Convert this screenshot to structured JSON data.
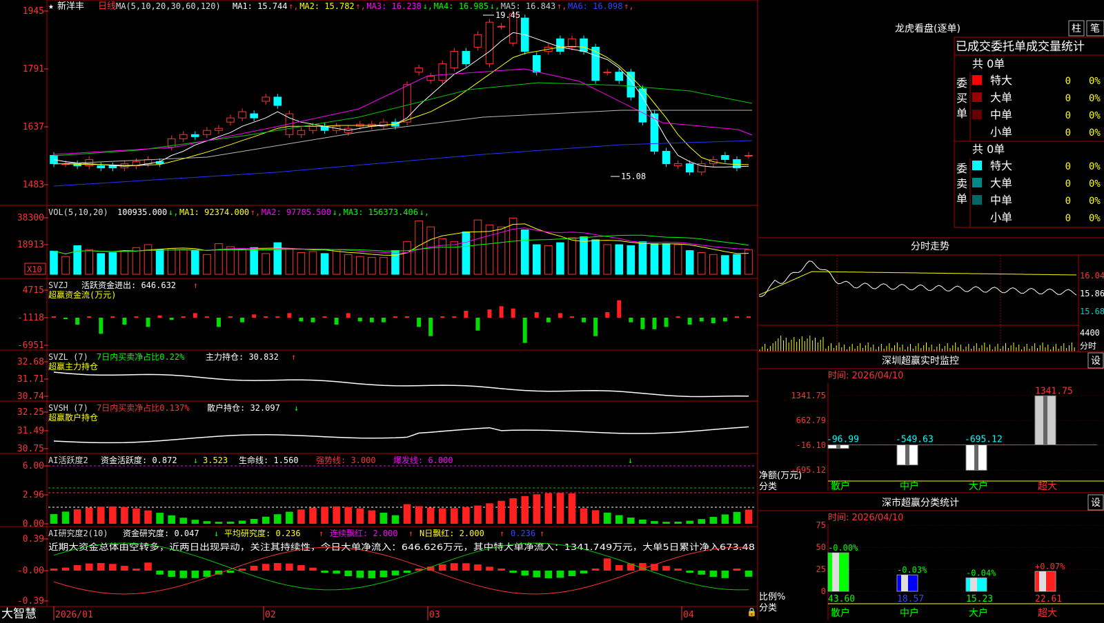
{
  "stock": {
    "name": "新洋丰",
    "period": "日线"
  },
  "main_chart": {
    "ma_label": "MA(5,10,20,30,60,120)",
    "ma_values": [
      {
        "label": "MA1:",
        "value": "15.744",
        "arrow": "↑",
        "color": "#ffffff"
      },
      {
        "label": "MA2:",
        "value": "15.782",
        "arrow": "↑",
        "color": "#ffff00"
      },
      {
        "label": "MA3:",
        "value": "16.238",
        "arrow": "↓",
        "color": "#ff00ff"
      },
      {
        "label": "MA4:",
        "value": "16.985",
        "arrow": "↓",
        "color": "#00ff00"
      },
      {
        "label": "MA5:",
        "value": "16.843",
        "arrow": "↑",
        "color": "#cccccc"
      },
      {
        "label": "MA6:",
        "value": "16.098",
        "arrow": "↑",
        "color": "#3344ff"
      }
    ],
    "y_ticks": [
      "1945",
      "1791",
      "1637",
      "1483"
    ],
    "high_label": "19.45",
    "low_label": "15.08"
  },
  "vol_panel": {
    "title": "VOL(5,10,20)",
    "values": [
      {
        "label": "",
        "value": "100935.000",
        "arrow": "↓",
        "color": "#ffffff"
      },
      {
        "label": "MA1:",
        "value": "92374.000",
        "arrow": "↑",
        "color": "#ffff00"
      },
      {
        "label": "MA2:",
        "value": "97785.500",
        "arrow": "↓",
        "color": "#ff00ff"
      },
      {
        "label": "MA3:",
        "value": "156373.406",
        "arrow": "↓",
        "color": "#00ff00"
      }
    ],
    "y_ticks": [
      "38300",
      "18913"
    ],
    "unit": "X10"
  },
  "svzj_panel": {
    "title": "SVZJ",
    "line1": "活跃资金进出: 646.632",
    "arrow": "↑",
    "line2": "超赢资金流(万元)",
    "y_ticks": [
      "4715",
      "-1118",
      "-6951"
    ]
  },
  "svzl_panel": {
    "title": "SVZL (7)",
    "ratio": "7日内买卖净占比0.22%",
    "hold": "主力持仓: 30.832",
    "arrow": "↑",
    "line2": "超赢主力持仓",
    "y_ticks": [
      "32.68",
      "31.71",
      "30.74"
    ]
  },
  "svsh_panel": {
    "title": "SVSH (7)",
    "ratio": "7日内买卖净占比0.137%",
    "hold": "散户持仓: 32.097",
    "arrow": "↓",
    "line2": "超赢散户持仓",
    "y_ticks": [
      "32.25",
      "31.49",
      "30.75"
    ]
  },
  "ai_active": {
    "title": "AI活跃度2",
    "a": "资金活跃度: 0.872",
    "a_arrow": "↓",
    "b": "3.523",
    "c": "生命线: 1.560",
    "d": "强势线: 3.000",
    "e": "爆发线: 6.000",
    "y_ticks": [
      "6.00",
      "2.96",
      "0.00"
    ]
  },
  "ai_research": {
    "title": "AI研究度2(10)",
    "a": "资金研究度: 0.047",
    "a_arrow": "↓",
    "b": "平均研究度: 0.236",
    "b_arrow": "↑",
    "c": "连续飘红: 2.000",
    "c_arrow": "↑",
    "d": "N日飘红: 2.000",
    "d_arrow": "↑",
    "e": "0.236",
    "e_arrow": "↑",
    "comment": "近期大资金总体由空转多，近两日出现异动，关注其持续性，今日大单净流入：646.626万元，其中特大单净流入：1341.749万元，大单5日累计净入673.48",
    "y_ticks": [
      "0.39",
      "-0.00",
      "-0.39"
    ]
  },
  "x_axis": [
    "2026/01",
    "02",
    "03",
    "04"
  ],
  "brand": "大智慧",
  "dragon": {
    "title": "龙虎看盘(逐单)",
    "btn_zhu": "柱",
    "btn_bi": "笔",
    "header": "已成交委托单成交量统计",
    "buy_label": "委买单",
    "sell_label": "委卖单",
    "buy_total": "共 0单",
    "sell_total": "共 0单",
    "buy_rows": [
      {
        "name": "特大",
        "count": "0",
        "pct": "0%",
        "color": "#ff0000"
      },
      {
        "name": "大单",
        "count": "0",
        "pct": "0%",
        "color": "#990000"
      },
      {
        "name": "中单",
        "count": "0",
        "pct": "0%",
        "color": "#660000"
      },
      {
        "name": "小单",
        "count": "0",
        "pct": "0%",
        "color": "#000000"
      }
    ],
    "sell_rows": [
      {
        "name": "特大",
        "count": "0",
        "pct": "0%",
        "color": "#00ffff"
      },
      {
        "name": "大单",
        "count": "0",
        "pct": "0%",
        "color": "#008888"
      },
      {
        "name": "中单",
        "count": "0",
        "pct": "0%",
        "color": "#006666"
      },
      {
        "name": "小单",
        "count": "0",
        "pct": "0%",
        "color": "#000000"
      }
    ]
  },
  "intraday": {
    "title": "分时走势",
    "y_ticks": [
      "16.04",
      "15.86",
      "15.68"
    ],
    "vol_tick": "4400",
    "unit": "分时"
  },
  "monitor": {
    "title": "深圳超赢实时监控",
    "btn": "设",
    "time": "时间: 2026/04/10",
    "y_ticks": [
      "1341.75",
      "662.79",
      "-16.10",
      "-695.12"
    ],
    "bars": [
      {
        "label": "散户",
        "value": "-96.99",
        "num": -96.99
      },
      {
        "label": "中户",
        "value": "-549.63",
        "num": -549.63
      },
      {
        "label": "大户",
        "value": "-695.12",
        "num": -695.12
      },
      {
        "label": "超大",
        "value": "1341.75",
        "num": 1341.75
      }
    ],
    "ylabel": "净额(万元)",
    "xlabel": "分类"
  },
  "classify": {
    "title": "深市超赢分类统计",
    "btn": "设",
    "time": "时间: 2026/04/10",
    "y_ticks": [
      "75",
      "50",
      "25",
      "0"
    ],
    "bars": [
      {
        "label": "散户",
        "value": "43.60",
        "num": 43.6,
        "delta": "-0.00%"
      },
      {
        "label": "中户",
        "value": "18.57",
        "num": 18.57,
        "delta": "-0.03%"
      },
      {
        "label": "大户",
        "value": "15.23",
        "num": 15.23,
        "delta": "-0.04%"
      },
      {
        "label": "超大",
        "value": "22.61",
        "num": 22.61,
        "delta": "+0.07%"
      }
    ],
    "ylabel": "比例%",
    "xlabel": "分类"
  },
  "chart_data": {
    "type": "candlestick",
    "x": [
      1,
      2,
      3,
      4,
      5,
      6,
      7,
      8,
      9,
      10,
      11,
      12,
      13,
      14,
      15,
      16,
      17,
      18,
      19,
      20,
      21,
      22,
      23,
      24,
      25,
      26,
      27,
      28,
      29,
      30,
      31,
      32,
      33,
      34,
      35,
      36,
      37,
      38,
      39,
      40,
      41,
      42,
      43,
      44,
      45,
      46,
      47,
      48,
      49,
      50,
      51,
      52,
      53,
      54,
      55,
      56,
      57,
      58,
      59,
      60
    ],
    "open": [
      16.0,
      15.8,
      15.8,
      15.75,
      15.75,
      15.75,
      15.7,
      15.75,
      15.8,
      15.85,
      16.2,
      16.4,
      16.5,
      16.5,
      16.6,
      16.8,
      16.9,
      17.0,
      17.3,
      17.4,
      16.5,
      16.5,
      16.6,
      16.7,
      16.6,
      16.55,
      16.7,
      16.7,
      16.7,
      16.8,
      16.8,
      18.0,
      17.8,
      17.8,
      18.1,
      18.5,
      18.6,
      18.2,
      19.1,
      18.7,
      19.3,
      18.4,
      18.5,
      18.8,
      18.6,
      18.8,
      18.6,
      18.0,
      18.0,
      18.0,
      17.6,
      17.0,
      16.1,
      15.75,
      15.8,
      15.6,
      15.8,
      16.0,
      15.9,
      16.0
    ],
    "close": [
      15.8,
      15.8,
      15.75,
      15.9,
      15.7,
      15.7,
      15.8,
      15.85,
      15.9,
      15.8,
      16.4,
      16.5,
      16.45,
      16.6,
      16.65,
      16.9,
      17.05,
      16.9,
      17.4,
      17.2,
      17.0,
      16.6,
      16.7,
      16.6,
      16.7,
      16.65,
      16.75,
      16.75,
      16.8,
      16.7,
      17.7,
      18.1,
      17.9,
      18.2,
      18.5,
      18.2,
      18.9,
      19.2,
      19.1,
      19.4,
      18.5,
      18.0,
      18.6,
      18.5,
      18.8,
      18.5,
      17.8,
      18.0,
      17.8,
      17.4,
      16.8,
      16.1,
      15.8,
      15.8,
      15.6,
      15.8,
      15.9,
      15.9,
      15.7,
      16.0
    ],
    "price_range": [
      14.8,
      19.6
    ],
    "volume": [
      23500,
      18000,
      29000,
      25000,
      21000,
      22000,
      23000,
      27000,
      30000,
      25000,
      26000,
      25000,
      24000,
      20000,
      31000,
      28000,
      25000,
      27000,
      21000,
      32000,
      26000,
      22000,
      23000,
      21000,
      25000,
      20000,
      18000,
      17000,
      17000,
      24000,
      33000,
      54000,
      48000,
      36000,
      33000,
      43000,
      55000,
      50000,
      48000,
      57000,
      45000,
      30000,
      29000,
      32000,
      37000,
      38000,
      35000,
      30000,
      30000,
      29000,
      33000,
      31000,
      31000,
      30000,
      24000,
      22000,
      20000,
      19000,
      20000,
      25000
    ],
    "svzj": [
      0,
      -300,
      -1500,
      0,
      -3500,
      0,
      -1500,
      0,
      -2000,
      500,
      -500,
      0,
      1000,
      0,
      -2000,
      0,
      -1000,
      700,
      0,
      0,
      1000,
      -800,
      -1000,
      0,
      -1500,
      1000,
      -800,
      -1000,
      -1000,
      0,
      0,
      -2000,
      -4000,
      0,
      0,
      1500,
      -2800,
      1800,
      2500,
      2000,
      -5500,
      1200,
      -1000,
      1000,
      0,
      -1000,
      -4000,
      1200,
      3800,
      -1000,
      -2500,
      -2500,
      -2000,
      0,
      -1500,
      -800,
      -1200,
      -800,
      0,
      0
    ],
    "series": [
      {
        "name": "MA1",
        "values": [
          15.9,
          15.85,
          15.82,
          15.8,
          15.78,
          15.76,
          15.74,
          15.76,
          15.8,
          15.85,
          16.0,
          16.1,
          16.25,
          16.35,
          16.45,
          16.55,
          16.7,
          16.8,
          16.9,
          17.05,
          16.9,
          16.8,
          16.75,
          16.7,
          16.65,
          16.6,
          16.65,
          16.7,
          16.72,
          16.75,
          16.9,
          17.2,
          17.45,
          17.7,
          17.95,
          18.1,
          18.3,
          18.5,
          18.75,
          18.95,
          18.9,
          18.8,
          18.7,
          18.6,
          18.55,
          18.5,
          18.4,
          18.3,
          18.1,
          17.8,
          17.4,
          16.9,
          16.4,
          16.0,
          15.85,
          15.75,
          15.72,
          15.72,
          15.73,
          15.74
        ]
      },
      {
        "name": "MA2",
        "values": [
          15.8,
          15.8,
          15.79,
          15.78,
          15.78,
          15.77,
          15.76,
          15.76,
          15.77,
          15.78,
          15.85,
          15.92,
          16.0,
          16.08,
          16.17,
          16.26,
          16.36,
          16.45,
          16.55,
          16.65,
          16.7,
          16.7,
          16.7,
          16.7,
          16.72,
          16.72,
          16.72,
          16.72,
          16.73,
          16.75,
          16.85,
          16.95,
          17.05,
          17.2,
          17.35,
          17.55,
          17.75,
          17.95,
          18.15,
          18.35,
          18.45,
          18.5,
          18.55,
          18.6,
          18.62,
          18.6,
          18.5,
          18.35,
          18.15,
          17.9,
          17.6,
          17.25,
          16.9,
          16.5,
          16.2,
          15.95,
          15.85,
          15.8,
          15.78,
          15.78
        ]
      }
    ]
  }
}
